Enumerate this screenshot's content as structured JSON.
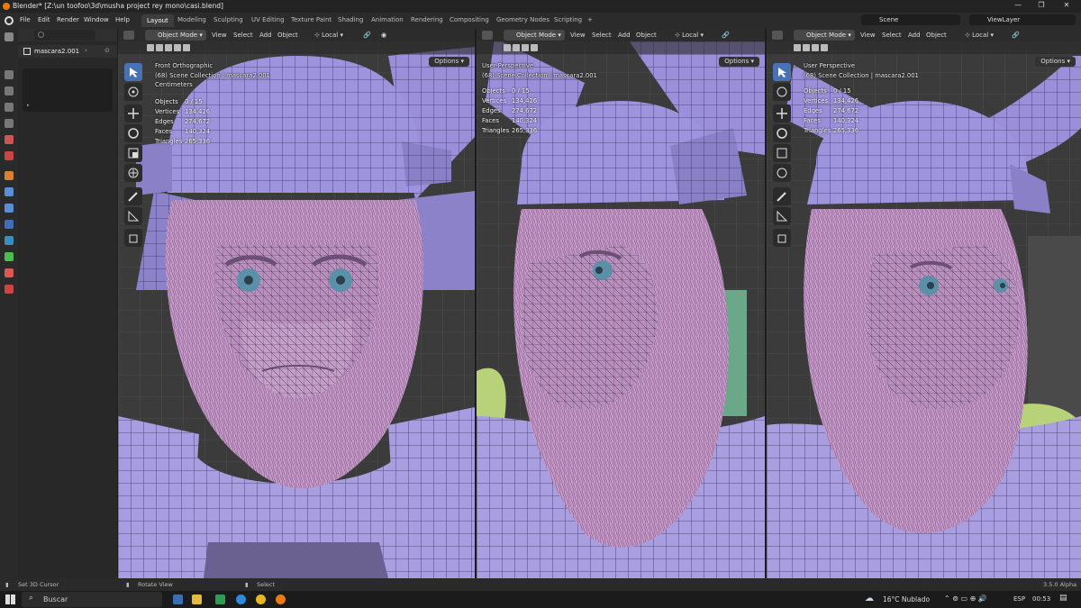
{
  "window": {
    "title": "Blender* [Z:\\un toofoo\\3d\\musha project rey mono\\casi.blend]"
  },
  "menu": [
    "File",
    "Edit",
    "Render",
    "Window",
    "Help"
  ],
  "workspaces": [
    "Layout",
    "Modeling",
    "Sculpting",
    "UV Editing",
    "Texture Paint",
    "Shading",
    "Animation",
    "Rendering",
    "Compositing",
    "Geometry Nodes",
    "Scripting"
  ],
  "add_workspace": "+",
  "scene_field": "Scene",
  "viewlayer_field": "ViewLayer",
  "outliner": {
    "object": "mascara2.001"
  },
  "header": {
    "mode": "Object Mode",
    "view": "View",
    "select": "Select",
    "add": "Add",
    "object": "Object",
    "orientation": "Local",
    "options": "Options"
  },
  "viewports": [
    {
      "view_name": "Front Orthographic",
      "collection": "(68) Scene Collection | mascara2.001",
      "units": "Centimeters",
      "stats": {
        "objects": "0 / 15",
        "vertices": "134,426",
        "edges": "274,672",
        "faces": "140,324",
        "triangles": "265,336"
      }
    },
    {
      "view_name": "User Perspective",
      "collection": "(68) Scene Collection | mascara2.001",
      "stats": {
        "objects": "0 / 15",
        "vertices": "134,426",
        "edges": "274,672",
        "faces": "140,324",
        "triangles": "265,336"
      }
    },
    {
      "view_name": "User Perspective",
      "collection": "(68) Scene Collection | mascara2.001",
      "stats": {
        "objects": "0 / 15",
        "vertices": "134,426",
        "edges": "274,672",
        "faces": "140,324",
        "triangles": "265,336"
      }
    }
  ],
  "stat_labels": {
    "objects": "Objects",
    "vertices": "Vertices",
    "edges": "Edges",
    "faces": "Faces",
    "triangles": "Triangles"
  },
  "statusbar": {
    "left": "Set 3D Cursor",
    "mid": "Rotate View",
    "mid2": "Select",
    "version": "3.5.0 Alpha"
  },
  "taskbar": {
    "search": "Buscar",
    "weather": "16°C  Nublado",
    "lang": "ESP",
    "time": "00:53"
  },
  "colors": {
    "accent": "#4772b3",
    "mesh": "#9a8fd8",
    "fur": "#c79ac9",
    "eye": "#5c8fa8"
  }
}
